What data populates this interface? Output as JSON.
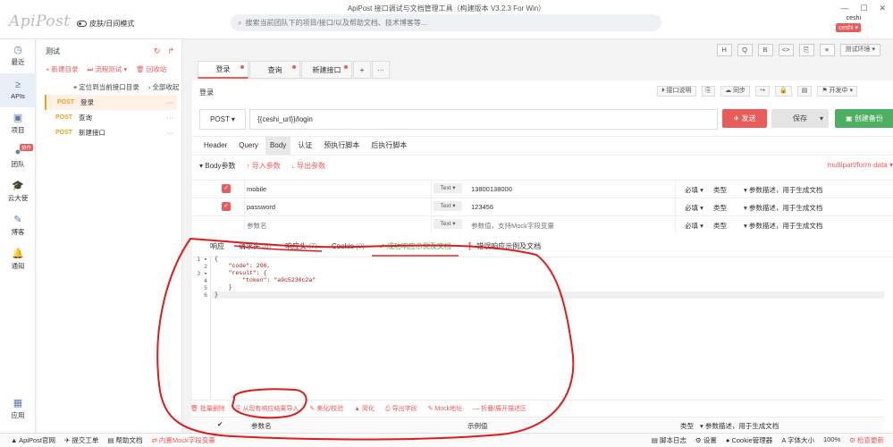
{
  "app": {
    "logo": "ApiPost",
    "skin_label": "皮肤/日间模式",
    "title": "ApiPost 接口调试与文档管理工具（构建版本 V3.2.3 For Win）",
    "search_placeholder": "搜索当前团队下的项目/接口/以及帮助文档、技术博客等...",
    "user_name": "ceshi",
    "user_avatar": "ceshi"
  },
  "rail": [
    {
      "label": "最近",
      "icon": "◷"
    },
    {
      "label": "APIs",
      "icon": "≥"
    },
    {
      "label": "项目",
      "icon": "▣"
    },
    {
      "label": "团队",
      "icon": "●",
      "badge": "协作"
    },
    {
      "label": "云大使",
      "icon": "🎓"
    },
    {
      "label": "博客",
      "icon": "✎"
    },
    {
      "label": "通知",
      "icon": "🔔"
    }
  ],
  "rail_bottom": {
    "label": "应用",
    "icon": "▦"
  },
  "tree": {
    "project": "测试",
    "new_dir": "+ 新建目录",
    "flow_test": "⏭ 流程测试 ▾",
    "recycle": "🗑 回收站",
    "locate": "⌖ 定位到当前接口目录",
    "collapse": "› 全部收起",
    "items": [
      {
        "method": "POST",
        "name": "登录"
      },
      {
        "method": "POST",
        "name": "查询"
      },
      {
        "method": "POST",
        "name": "新建接口"
      }
    ]
  },
  "toolbar": {
    "tools": [
      "H",
      "Q",
      "B",
      "<>",
      "⎘",
      "≡"
    ],
    "env": "测试环境 ▾"
  },
  "tabs": [
    "登录",
    "查询",
    "新建接口"
  ],
  "tab_plus": "+",
  "tab_more": "···",
  "api": {
    "name": "登录",
    "acts": [
      "⏵ 接口说明",
      "⎘",
      "☁ 同步",
      "↪",
      "🔒",
      "▤",
      "⚑ 开发中 ▾"
    ],
    "method": "POST ▾",
    "url": "{{ceshi_url}}/login",
    "send": "✈ 发送",
    "save": "保存",
    "save_caret": "▾",
    "backup": "▣ 创建备份"
  },
  "req_tabs": [
    "Header",
    "Query",
    "Body",
    "认证",
    "预执行脚本",
    "后执行脚本"
  ],
  "body": {
    "label": "▾ Body参数",
    "import": "↑ 导入参数",
    "export": "↓ 导出参数",
    "content_type": "multipart/form-data ▾"
  },
  "params": [
    {
      "checked": true,
      "key": "mobile",
      "type": "Text ▾",
      "value": "13800138000",
      "required": "必填 ▾",
      "dtype": "类型",
      "desc": "▾ 参数描述，用于生成文档"
    },
    {
      "checked": true,
      "key": "password",
      "type": "Text ▾",
      "value": "123456",
      "required": "必填 ▾",
      "dtype": "类型",
      "desc": "▾ 参数描述，用于生成文档"
    },
    {
      "checked": false,
      "key": "参数名",
      "type": "Text ▾",
      "value": "参数值，支持Mock字段变量",
      "required": "必填 ▾",
      "dtype": "类型",
      "desc": "▾ 参数描述，用于生成文档"
    }
  ],
  "resp_tabs": [
    {
      "label": "响应",
      "count": ""
    },
    {
      "label": "请求头",
      "count": "(6)"
    },
    {
      "label": "响应头",
      "count": "(7)"
    },
    {
      "label": "Cookie",
      "count": "(0)"
    },
    {
      "label": "✔ 成功响应示例及文档",
      "count": ""
    },
    {
      "label": "❗ 错误响应示例及文档",
      "count": ""
    }
  ],
  "code": {
    "line_numbers": [
      "1 ▾",
      "2",
      "3 ▾",
      "4",
      "5",
      "6"
    ],
    "lines": [
      "{",
      "    \"code\": 200,",
      "    \"result\": {",
      "        \"token\": \"a9c5230c2a\"",
      "    }",
      "}"
    ]
  },
  "bottom_acts": [
    "🗑 批量删除",
    "⎘ 从现有响应结果导入",
    "✎ 美化/校验",
    "▲ 简化",
    "⎙ 导出字段",
    "✎ Mock地址",
    "— 折叠/展开描述区"
  ],
  "bottom_head": {
    "check": "✔",
    "name": "参数名",
    "example": "示例值",
    "type": "类型",
    "desc": "▾ 参数描述，用于生成文档"
  },
  "statusbar": {
    "left": [
      "▲ ApiPost官网",
      "✈ 提交工单",
      "▤ 帮助文档",
      "⇄ 内置Mock字段变量"
    ],
    "right": [
      "▤ 脚本日志",
      "⚙ 设置",
      "● Cookie管理器",
      "A 字体大小",
      "100%",
      "⚙ 检查更新"
    ]
  },
  "colors": {
    "accent": "#e85c5c",
    "green": "#4caf62",
    "method": "#f0a020"
  }
}
